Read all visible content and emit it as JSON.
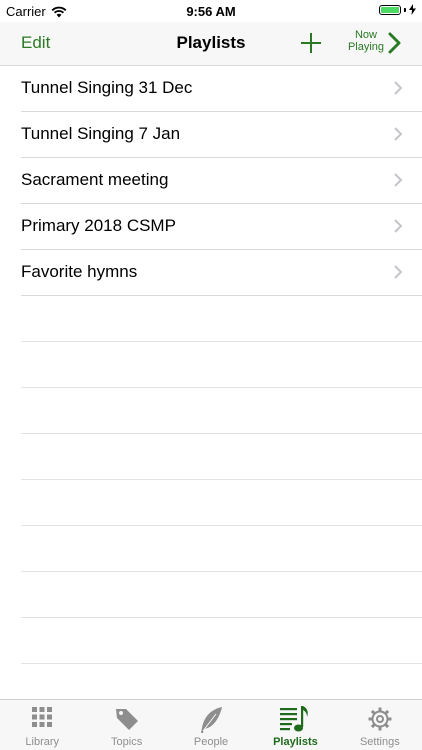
{
  "status": {
    "carrier": "Carrier",
    "time": "9:56 AM"
  },
  "nav": {
    "edit_label": "Edit",
    "title": "Playlists",
    "now_playing_line1": "Now",
    "now_playing_line2": "Playing"
  },
  "playlists": [
    {
      "label": "Tunnel Singing 31 Dec"
    },
    {
      "label": "Tunnel Singing 7 Jan"
    },
    {
      "label": "Sacrament meeting"
    },
    {
      "label": "Primary 2018 CSMP"
    },
    {
      "label": "Favorite hymns"
    }
  ],
  "tabs": [
    {
      "label": "Library",
      "icon": "grid-icon",
      "active": false
    },
    {
      "label": "Topics",
      "icon": "tag-icon",
      "active": false
    },
    {
      "label": "People",
      "icon": "feather-icon",
      "active": false
    },
    {
      "label": "Playlists",
      "icon": "playlist-icon",
      "active": true
    },
    {
      "label": "Settings",
      "icon": "gear-icon",
      "active": false
    }
  ],
  "colors": {
    "accent": "#2a7a23",
    "active_tab": "#1f6b1c",
    "inactive_tab": "#8e8e8e"
  }
}
